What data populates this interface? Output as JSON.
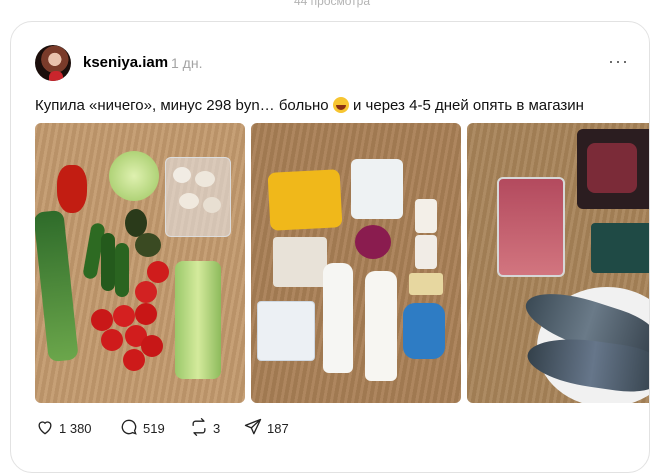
{
  "top": {
    "views": "44 просмотра"
  },
  "post": {
    "username": "kseniya.iam",
    "time": "1 дн.",
    "more": "···",
    "text_before": "Купила «ничего», минус 298 byn… больно",
    "text_after": "и через 4-5 дней опять в магазин",
    "emoji_icon": "grinning-sweat-emoji",
    "photos": [
      {
        "name": "vegetables-photo"
      },
      {
        "name": "dairy-products-photo"
      },
      {
        "name": "meat-fish-photo"
      }
    ]
  },
  "actions": {
    "likes": "1 380",
    "comments": "519",
    "reposts": "3",
    "shares": "187"
  }
}
